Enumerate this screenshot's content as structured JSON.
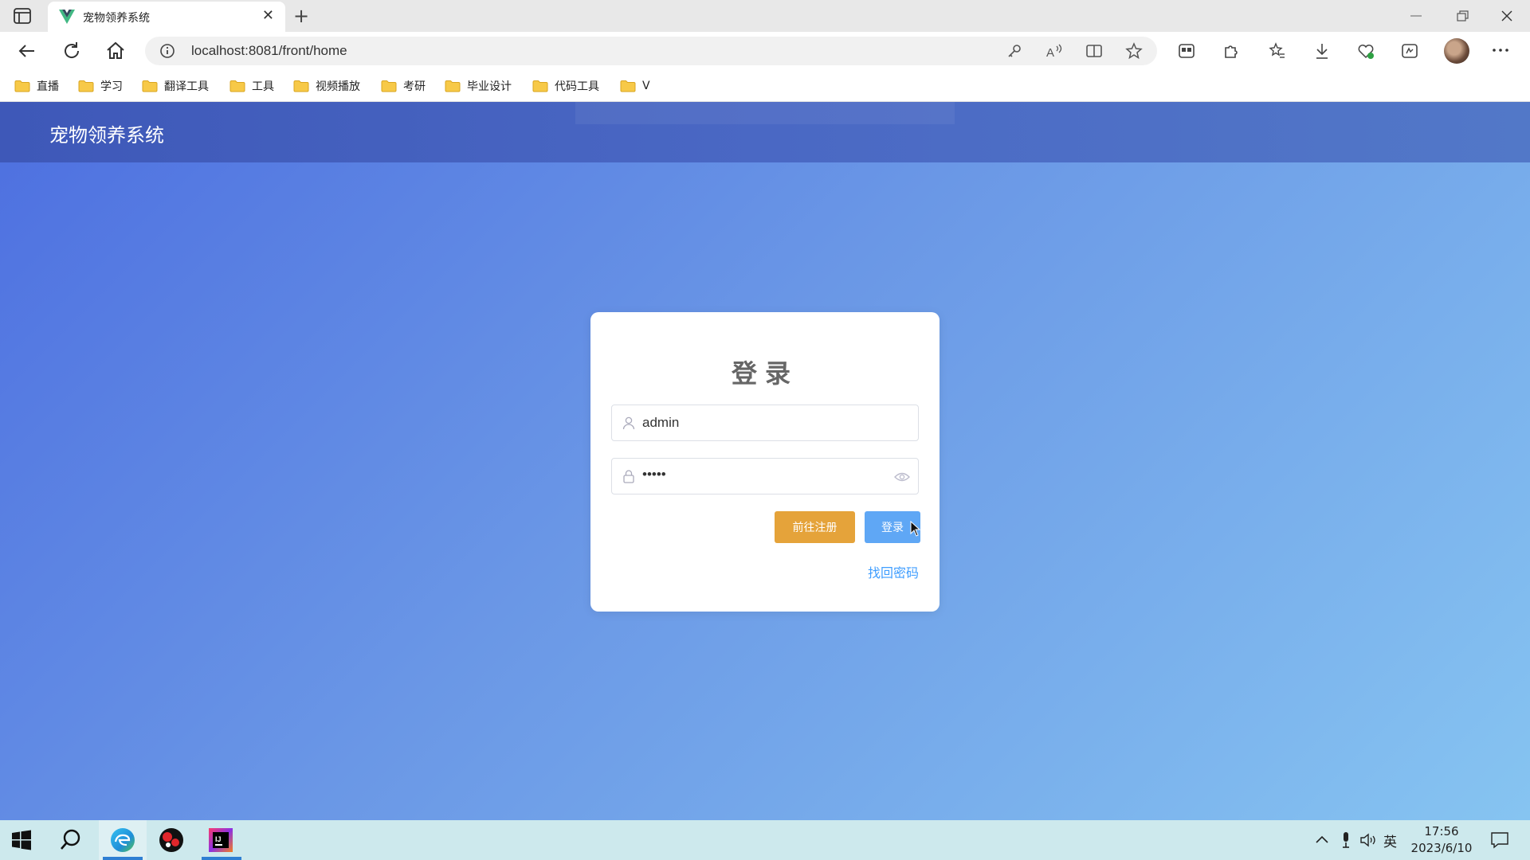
{
  "browser": {
    "tab_title": "宠物领养系统",
    "new_tab_glyph": "+",
    "close_glyph": "✕",
    "url": "localhost:8081/front/home",
    "bookmarks": [
      "直播",
      "学习",
      "翻译工具",
      "工具",
      "视频播放",
      "考研",
      "毕业设计",
      "代码工具",
      "V"
    ]
  },
  "site": {
    "title": "宠物领养系统"
  },
  "login": {
    "title": "登录",
    "username_value": "admin",
    "password_value": "•••••",
    "register_button": "前往注册",
    "login_button": "登录",
    "forgot_link": "找回密码"
  },
  "taskbar": {
    "ime": "英",
    "time": "17:56",
    "date": "2023/6/10"
  },
  "colors": {
    "header": "#4a68c4",
    "register_button": "#e5a33a",
    "login_button": "#5fa7f5",
    "link": "#409eff"
  }
}
